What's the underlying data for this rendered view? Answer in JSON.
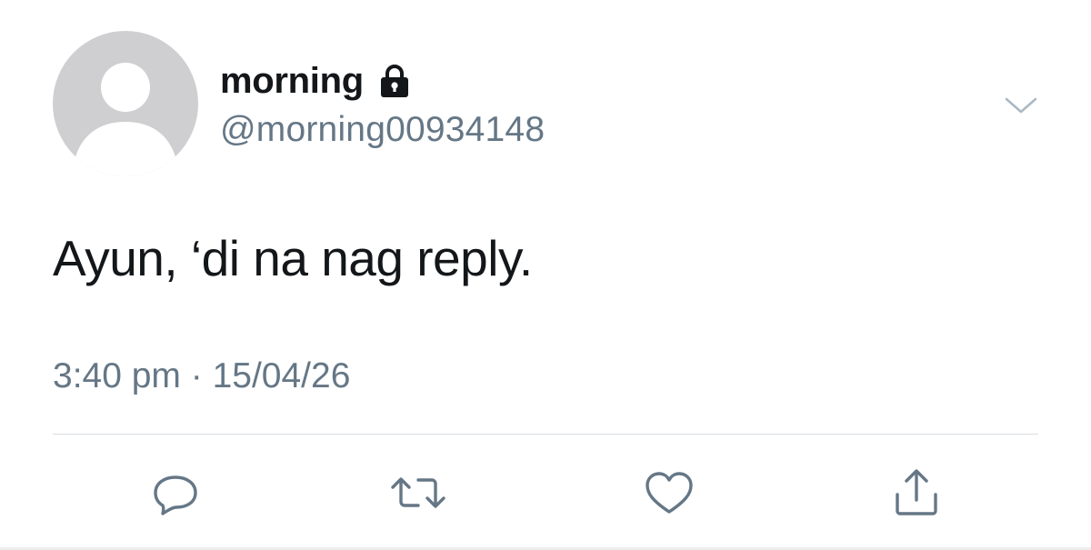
{
  "author": {
    "display_name": "morning",
    "handle": "@morning00934148",
    "protected": true
  },
  "tweet": {
    "text": "Ayun, ‘di na nag reply.",
    "timestamp": "3:40 pm · 15/04/26"
  },
  "icons": {
    "avatar": "default-avatar-icon",
    "lock": "lock-icon",
    "menu": "chevron-down-icon",
    "reply": "reply-icon",
    "retweet": "retweet-icon",
    "like": "heart-icon",
    "share": "share-icon"
  },
  "colors": {
    "primary_text": "#14171a",
    "secondary_text": "#657786",
    "divider": "#d8dde2",
    "avatar_bg": "#cfcfd2",
    "avatar_fg": "#ffffff"
  }
}
